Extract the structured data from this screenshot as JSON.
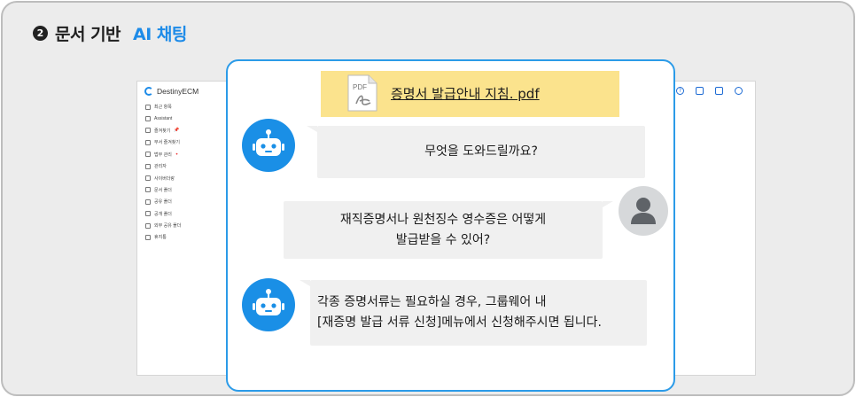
{
  "heading": {
    "step_number": "2",
    "title": "문서 기반",
    "accent": "AI 채팅"
  },
  "app": {
    "brand": "DestinyECM",
    "sidebar_items": [
      {
        "label": "최근 항목",
        "icon": "clock-icon"
      },
      {
        "label": "Assistant",
        "icon": "assistant-icon"
      },
      {
        "label": "즐겨찾기",
        "icon": "star-icon",
        "pinned": true
      },
      {
        "label": "부서 즐겨찾기",
        "icon": "folder-star-icon"
      },
      {
        "label": "법무 관리",
        "icon": "legal-icon",
        "badge": "•"
      },
      {
        "label": "관리자",
        "icon": "admin-icon"
      },
      {
        "label": "사이버더랑",
        "icon": "folder-icon"
      },
      {
        "label": "문서 폴더",
        "icon": "folder-icon"
      },
      {
        "label": "공유 폴더",
        "icon": "folder-icon"
      },
      {
        "label": "공개 폴더",
        "icon": "folder-icon"
      },
      {
        "label": "외부 공유 폴더",
        "icon": "folder-icon"
      },
      {
        "label": "휴지통",
        "icon": "trash-icon"
      }
    ],
    "top_icons": [
      "help-icon",
      "monitor-icon",
      "inbox-icon",
      "profile-icon"
    ]
  },
  "chat": {
    "document": {
      "file_type": "PDF",
      "name": "증명서 발급안내 지침. pdf"
    },
    "messages": [
      {
        "role": "bot",
        "lines": [
          "무엇을 도와드릴까요?"
        ]
      },
      {
        "role": "user",
        "lines": [
          "재직증명서나 원천징수 영수증은 어떻게",
          "발급받을 수 있어?"
        ]
      },
      {
        "role": "bot",
        "lines": [
          "각종 증명서류는 필요하실 경우, 그룹웨어 내",
          "[재증명 발급 서류 신청]메뉴에서 신청해주시면 됩니다."
        ]
      }
    ]
  },
  "colors": {
    "accent": "#1d8be8",
    "panel_border": "#2b9be8",
    "bot_avatar": "#1a8fe6",
    "doc_banner": "#fbe38d",
    "bubble": "#f0f0f0"
  }
}
